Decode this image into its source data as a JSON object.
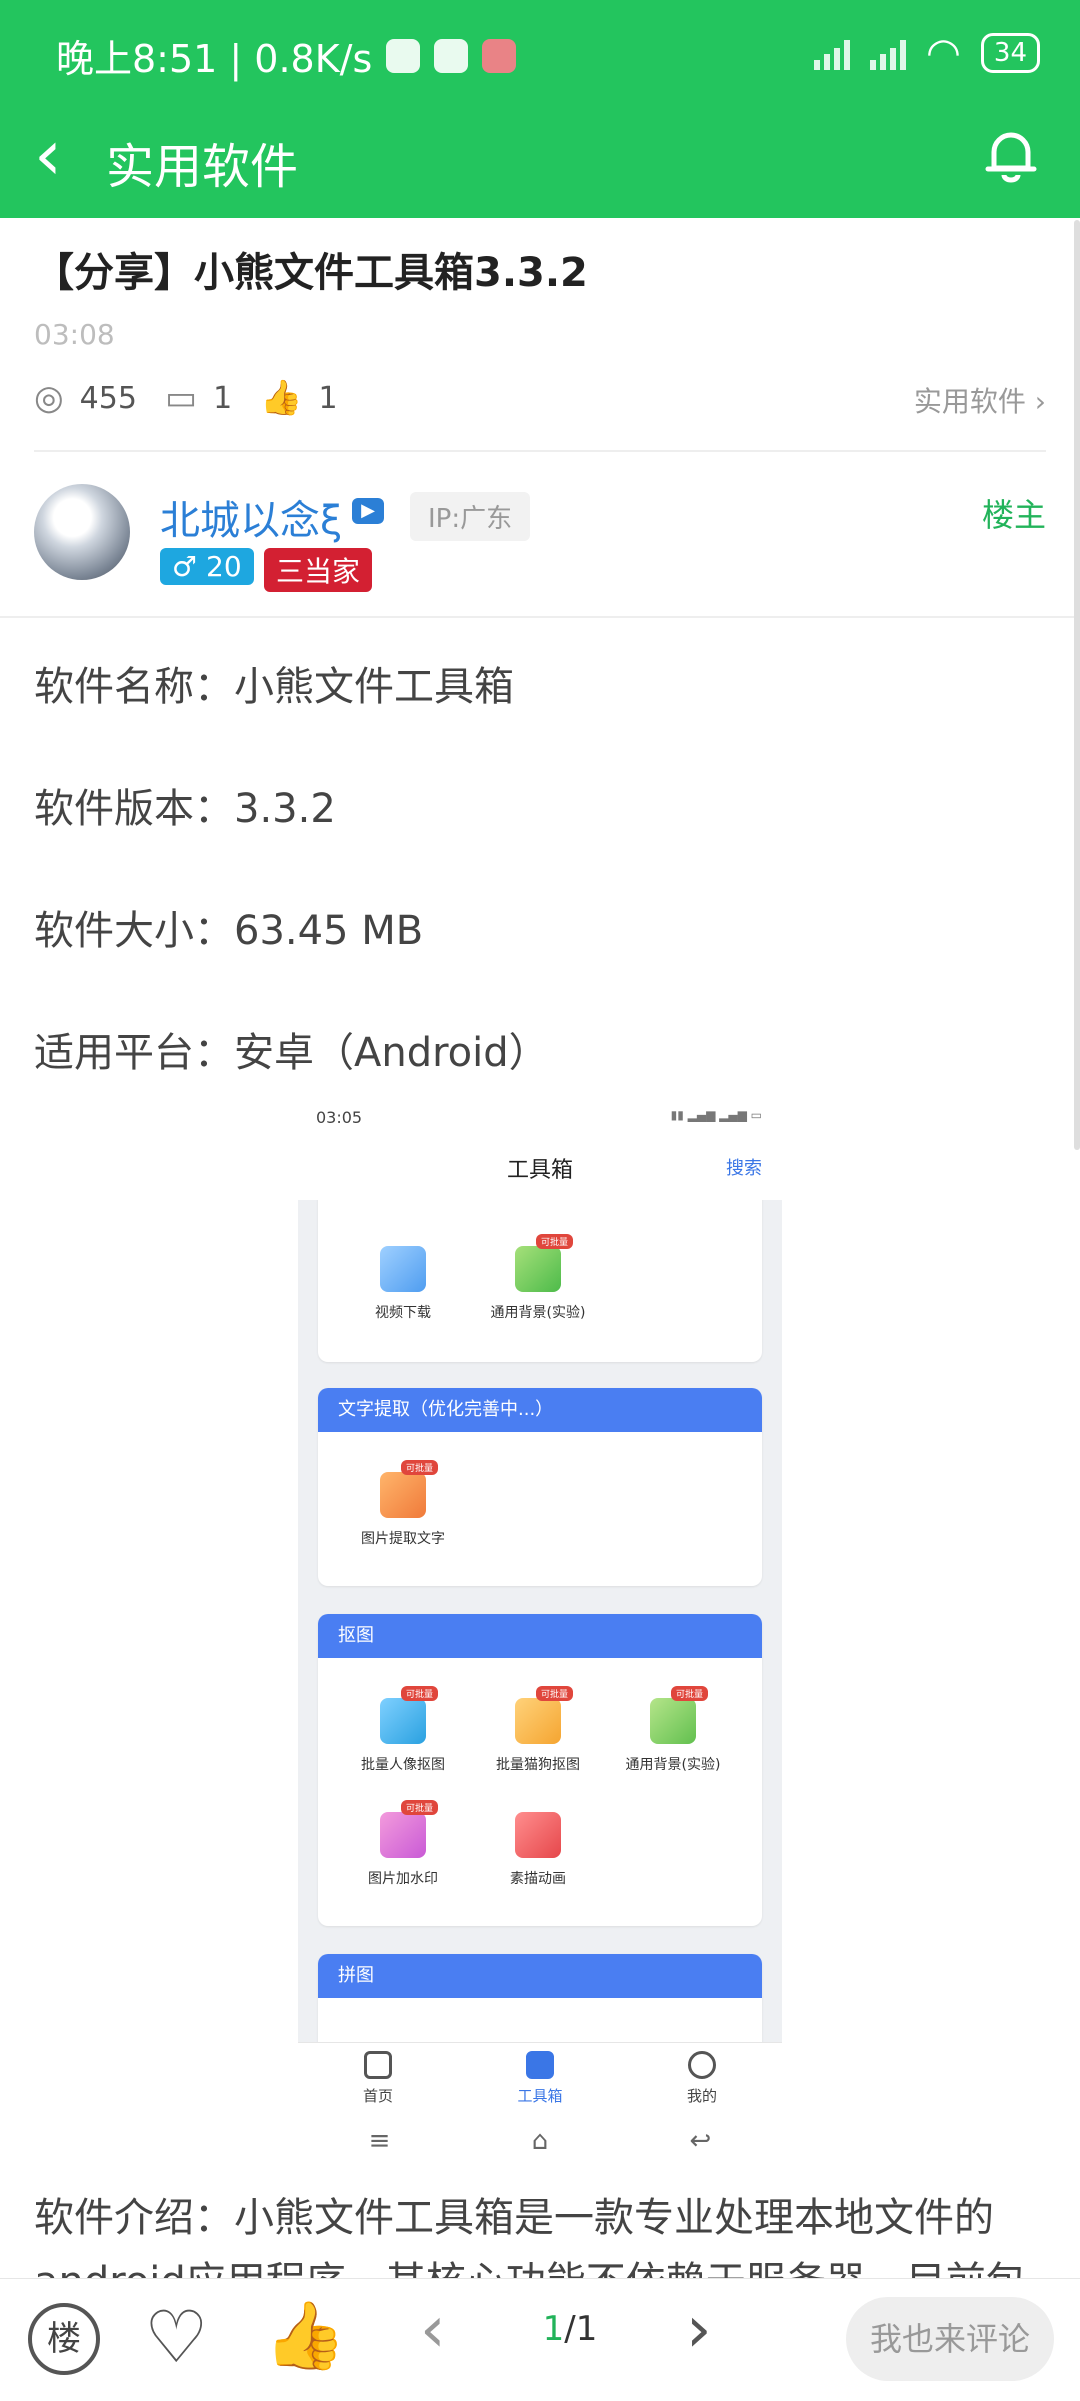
{
  "status_bar": {
    "left_text": "晚上8:51 | 0.8K/s",
    "battery": "34"
  },
  "nav": {
    "title": "实用软件"
  },
  "post": {
    "title": "【分享】小熊文件工具箱3.3.2",
    "time": "03:08",
    "views": "455",
    "comments": "1",
    "likes": "1",
    "category": "实用软件"
  },
  "author": {
    "name": "北城以念ξ",
    "ip": "IP:广东",
    "gender_badge": "♂ 20",
    "level_badge": "三当家",
    "role": "楼主"
  },
  "info": [
    {
      "label": "软件名称：小熊文件工具箱"
    },
    {
      "label": "软件版本：3.3.2"
    },
    {
      "label": "软件大小：63.45 MB"
    },
    {
      "label": "适用平台：安卓（Android）"
    }
  ],
  "screenshot": {
    "time": "03:05",
    "title": "工具箱",
    "search": "搜索",
    "cards": [
      {
        "tools": [
          {
            "label": "视频下载"
          },
          {
            "label": "通用背景(实验)",
            "tag": "可批量"
          }
        ]
      },
      {
        "title": "文字提取（优化完善中...）",
        "tools": [
          {
            "label": "图片提取文字",
            "tag": "可批量"
          }
        ]
      },
      {
        "title": "抠图",
        "tools": [
          {
            "label": "批量人像抠图",
            "tag": "可批量"
          },
          {
            "label": "批量猫狗抠图",
            "tag": "可批量"
          },
          {
            "label": "通用背景(实验)",
            "tag": "可批量"
          },
          {
            "label": "图片加水印",
            "tag": "可批量"
          },
          {
            "label": "素描动画"
          }
        ]
      },
      {
        "title": "拼图"
      }
    ],
    "tabs": [
      {
        "label": "首页"
      },
      {
        "label": "工具箱"
      },
      {
        "label": "我的"
      }
    ]
  },
  "intro": "软件介绍：小熊文件工具箱是一款专业处理本地文件的android应用程序，其核心功能不依赖于服务器，目前包",
  "bottom": {
    "floor": "楼",
    "page_current": "1",
    "page_total": "/1",
    "comment": "我也来评论"
  },
  "colors": {
    "brand": "#23c55e",
    "link": "#2b7fd6",
    "accent_blue": "#4a7ef2"
  }
}
